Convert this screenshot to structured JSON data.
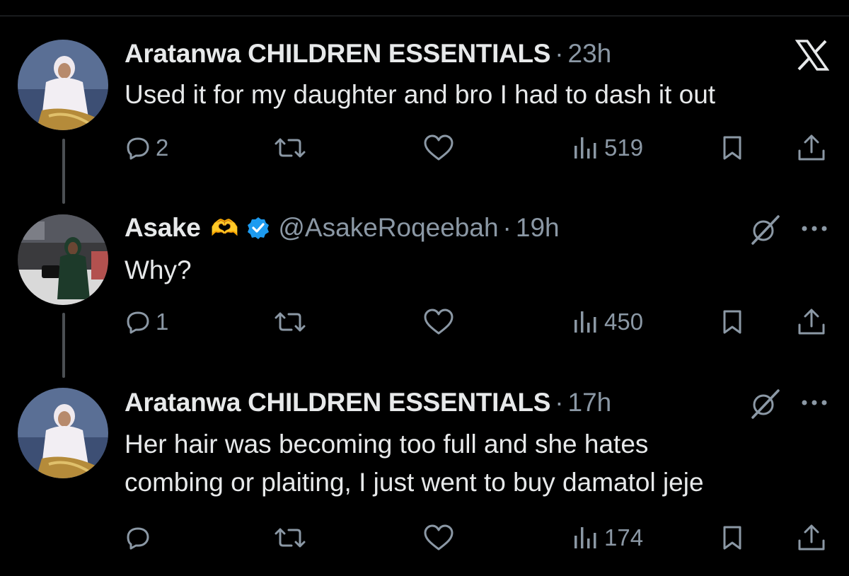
{
  "tweets": [
    {
      "name": "Aratanwa CHILDREN ESSENTIALS",
      "emoji": "",
      "handle": "",
      "dot": "·",
      "time": "23h",
      "text_lines": [
        "Used it for my daughter and bro I had to dash it out"
      ],
      "replies": "2",
      "views": "519",
      "avatar_icon": "avatar-woman-white-hijab"
    },
    {
      "name": "Asake",
      "emoji": "🫶",
      "handle": "@AsakeRoqeebah",
      "dot": "·",
      "time": "19h",
      "text_lines": [
        "Why?"
      ],
      "replies": "1",
      "views": "450",
      "avatar_icon": "avatar-woman-green-hijab"
    },
    {
      "name": "Aratanwa CHILDREN ESSENTIALS",
      "emoji": "",
      "handle": "",
      "dot": "·",
      "time": "17h",
      "text_lines": [
        "Her hair was becoming too full and she hates",
        "combing or plaiting, I just went to buy damatol jeje"
      ],
      "replies": "",
      "views": "174",
      "avatar_icon": "avatar-woman-white-hijab"
    }
  ],
  "icons": {
    "platform": "x-logo-icon",
    "reply": "reply-icon",
    "repost": "repost-icon",
    "like": "like-icon",
    "views": "views-icon",
    "bookmark": "bookmark-icon",
    "share": "share-icon",
    "grok": "grok-icon",
    "more": "more-icon",
    "verified": "verified-badge-icon"
  },
  "colors": {
    "background": "#000000",
    "text": "#e7e9ea",
    "muted": "#8b98a5",
    "verified": "#1d9bf0"
  }
}
